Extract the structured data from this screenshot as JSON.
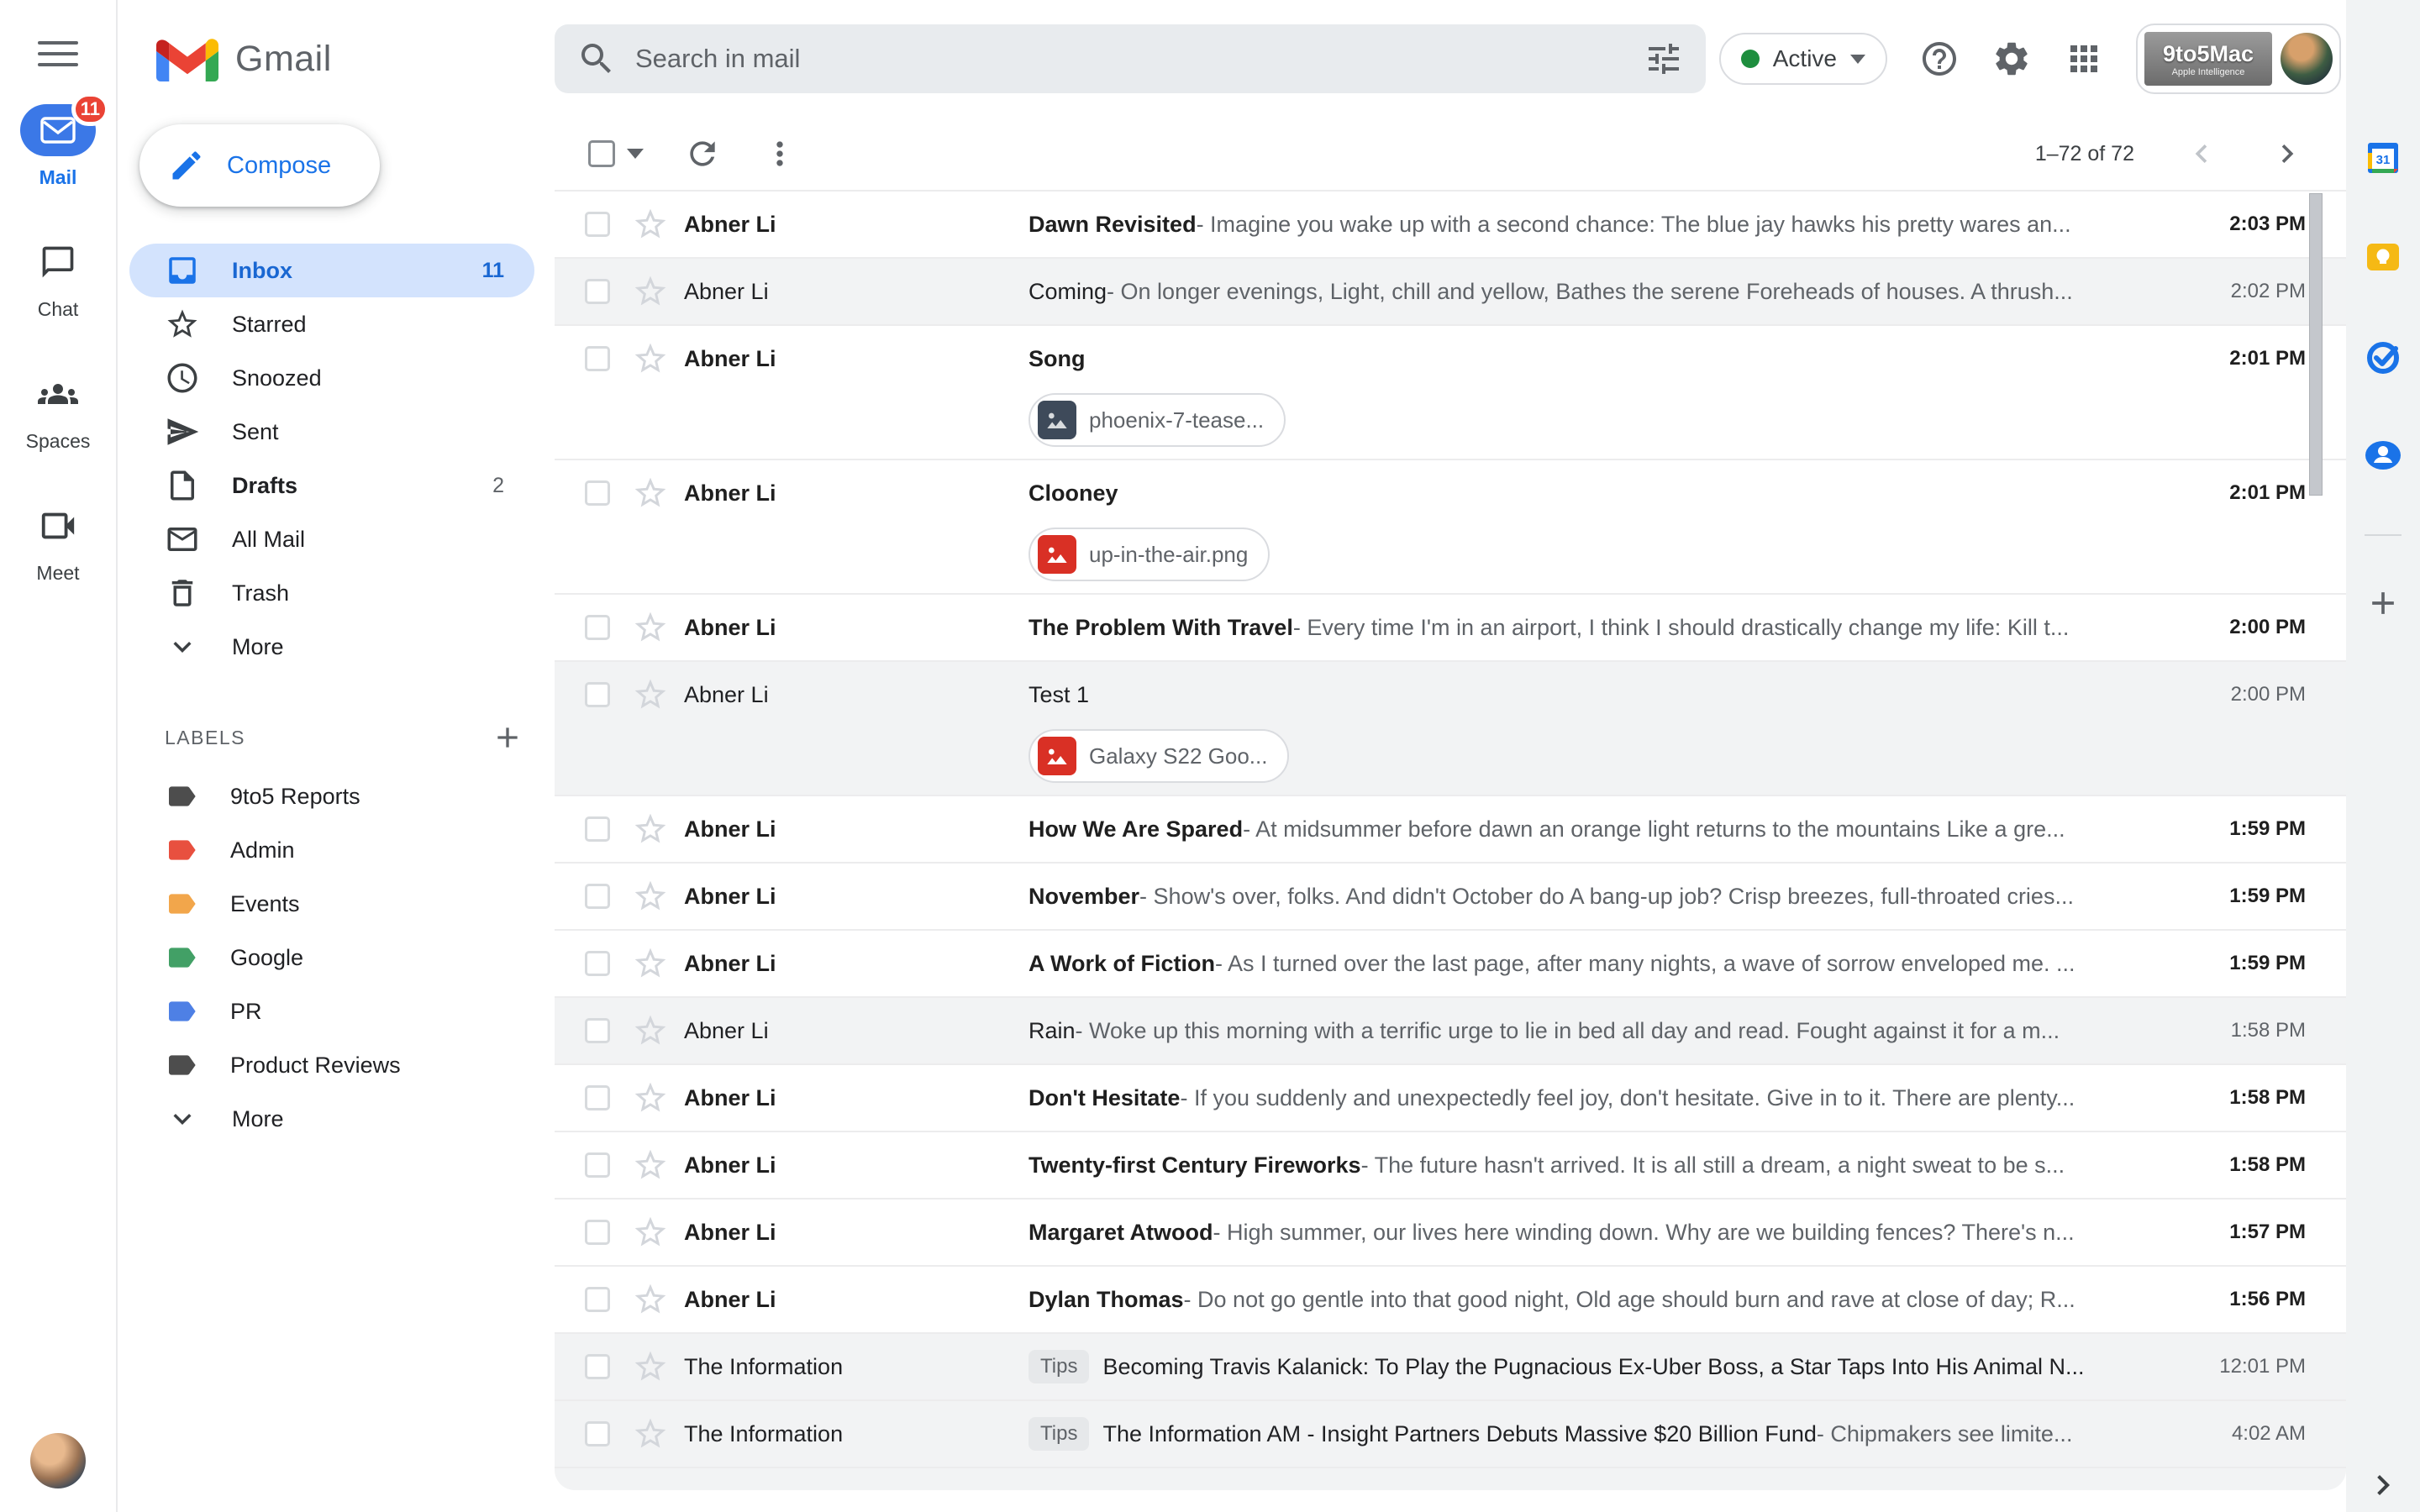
{
  "app": {
    "product_name": "Gmail"
  },
  "header": {
    "search_placeholder": "Search in mail",
    "status": {
      "label": "Active"
    },
    "workspace_logo": {
      "line1": "9to5Mac",
      "line2": "Apple Intelligence"
    }
  },
  "rail": {
    "items": [
      {
        "label": "Mail",
        "badge": "11",
        "active": true
      },
      {
        "label": "Chat",
        "active": false
      },
      {
        "label": "Spaces",
        "active": false
      },
      {
        "label": "Meet",
        "active": false
      }
    ]
  },
  "sidebar": {
    "compose_label": "Compose",
    "nav": [
      {
        "label": "Inbox",
        "count": "11"
      },
      {
        "label": "Starred",
        "count": ""
      },
      {
        "label": "Snoozed",
        "count": ""
      },
      {
        "label": "Sent",
        "count": ""
      },
      {
        "label": "Drafts",
        "count": "2"
      },
      {
        "label": "All Mail",
        "count": ""
      },
      {
        "label": "Trash",
        "count": ""
      },
      {
        "label": "More",
        "count": ""
      }
    ],
    "labels_title": "LABELS",
    "labels": [
      {
        "label": "9to5 Reports",
        "color": "#4d4d4d"
      },
      {
        "label": "Admin",
        "color": "#e8503f"
      },
      {
        "label": "Events",
        "color": "#f2a64b"
      },
      {
        "label": "Google",
        "color": "#42a066"
      },
      {
        "label": "PR",
        "color": "#4e80e5"
      },
      {
        "label": "Product Reviews",
        "color": "#4d4d4d"
      }
    ],
    "labels_more": "More"
  },
  "toolbar": {
    "pagination": "1–72 of 72"
  },
  "emails": [
    {
      "sender": "Abner Li",
      "unread": true,
      "subject": "Dawn Revisited",
      "snippet": "- Imagine you wake up with a second chance: The blue jay hawks his pretty wares an...",
      "time": "2:03 PM",
      "badge": null,
      "attachments": []
    },
    {
      "sender": "Abner Li",
      "unread": false,
      "subject": "Coming",
      "snippet": "- On longer evenings, Light, chill and yellow, Bathes the serene Foreheads of houses. A thrush...",
      "time": "2:02 PM",
      "badge": null,
      "attachments": []
    },
    {
      "sender": "Abner Li",
      "unread": true,
      "subject": "Song",
      "snippet": null,
      "time": "2:01 PM",
      "badge": null,
      "attachments": [
        {
          "name": "phoenix-7-tease...",
          "icon": "image-dark"
        }
      ]
    },
    {
      "sender": "Abner Li",
      "unread": true,
      "subject": "Clooney",
      "snippet": null,
      "time": "2:01 PM",
      "badge": null,
      "attachments": [
        {
          "name": "up-in-the-air.png",
          "icon": "image-red"
        }
      ]
    },
    {
      "sender": "Abner Li",
      "unread": true,
      "subject": "The Problem With Travel",
      "snippet": "- Every time I'm in an airport, I think I should drastically change my life: Kill t...",
      "time": "2:00 PM",
      "badge": null,
      "attachments": []
    },
    {
      "sender": "Abner Li",
      "unread": false,
      "subject": "Test 1",
      "snippet": null,
      "time": "2:00 PM",
      "badge": null,
      "attachments": [
        {
          "name": "Galaxy S22 Goo...",
          "icon": "image-red"
        }
      ]
    },
    {
      "sender": "Abner Li",
      "unread": true,
      "subject": "How We Are Spared",
      "snippet": "- At midsummer before dawn an orange light returns to the mountains Like a gre...",
      "time": "1:59 PM",
      "badge": null,
      "attachments": []
    },
    {
      "sender": "Abner Li",
      "unread": true,
      "subject": "November",
      "snippet": "- Show's over, folks. And didn't October do A bang-up job? Crisp breezes, full-throated cries...",
      "time": "1:59 PM",
      "badge": null,
      "attachments": []
    },
    {
      "sender": "Abner Li",
      "unread": true,
      "subject": "A Work of Fiction",
      "snippet": "- As I turned over the last page, after many nights, a wave of sorrow enveloped me. ...",
      "time": "1:59 PM",
      "badge": null,
      "attachments": []
    },
    {
      "sender": "Abner Li",
      "unread": false,
      "subject": "Rain",
      "snippet": "- Woke up this morning with a terrific urge to lie in bed all day and read. Fought against it for a m...",
      "time": "1:58 PM",
      "badge": null,
      "attachments": []
    },
    {
      "sender": "Abner Li",
      "unread": true,
      "subject": "Don't Hesitate",
      "snippet": "- If you suddenly and unexpectedly feel joy, don't hesitate. Give in to it. There are plenty...",
      "time": "1:58 PM",
      "badge": null,
      "attachments": []
    },
    {
      "sender": "Abner Li",
      "unread": true,
      "subject": "Twenty-first Century Fireworks",
      "snippet": "- The future hasn't arrived. It is all still a dream, a night sweat to be s...",
      "time": "1:58 PM",
      "badge": null,
      "attachments": []
    },
    {
      "sender": "Abner Li",
      "unread": true,
      "subject": "Margaret Atwood",
      "snippet": "- High summer, our lives here winding down. Why are we building fences? There's n...",
      "time": "1:57 PM",
      "badge": null,
      "attachments": []
    },
    {
      "sender": "Abner Li",
      "unread": true,
      "subject": "Dylan Thomas",
      "snippet": "- Do not go gentle into that good night, Old age should burn and rave at close of day; R...",
      "time": "1:56 PM",
      "badge": null,
      "attachments": []
    },
    {
      "sender": "The Information",
      "unread": false,
      "subject": "Becoming Travis Kalanick: To Play the Pugnacious Ex-Uber Boss, a Star Taps Into His Animal N...",
      "snippet": null,
      "time": "12:01 PM",
      "badge": "Tips",
      "attachments": []
    },
    {
      "sender": "The Information",
      "unread": false,
      "subject": "The Information AM - Insight Partners Debuts Massive $20 Billion Fund",
      "snippet": "- Chipmakers see limite...",
      "time": "4:02 AM",
      "badge": "Tips",
      "attachments": []
    }
  ],
  "colors": {
    "gmail_blue": "#1a73e8",
    "selected_pill": "#d3e3fd",
    "unread_text": "#1f1f1f",
    "read_row_bg": "#f2f3f4",
    "badge_red": "#ea4335",
    "status_green": "#1e8e3e",
    "search_bg": "#e8ebee",
    "panel_bg": "#f1f3f4"
  }
}
